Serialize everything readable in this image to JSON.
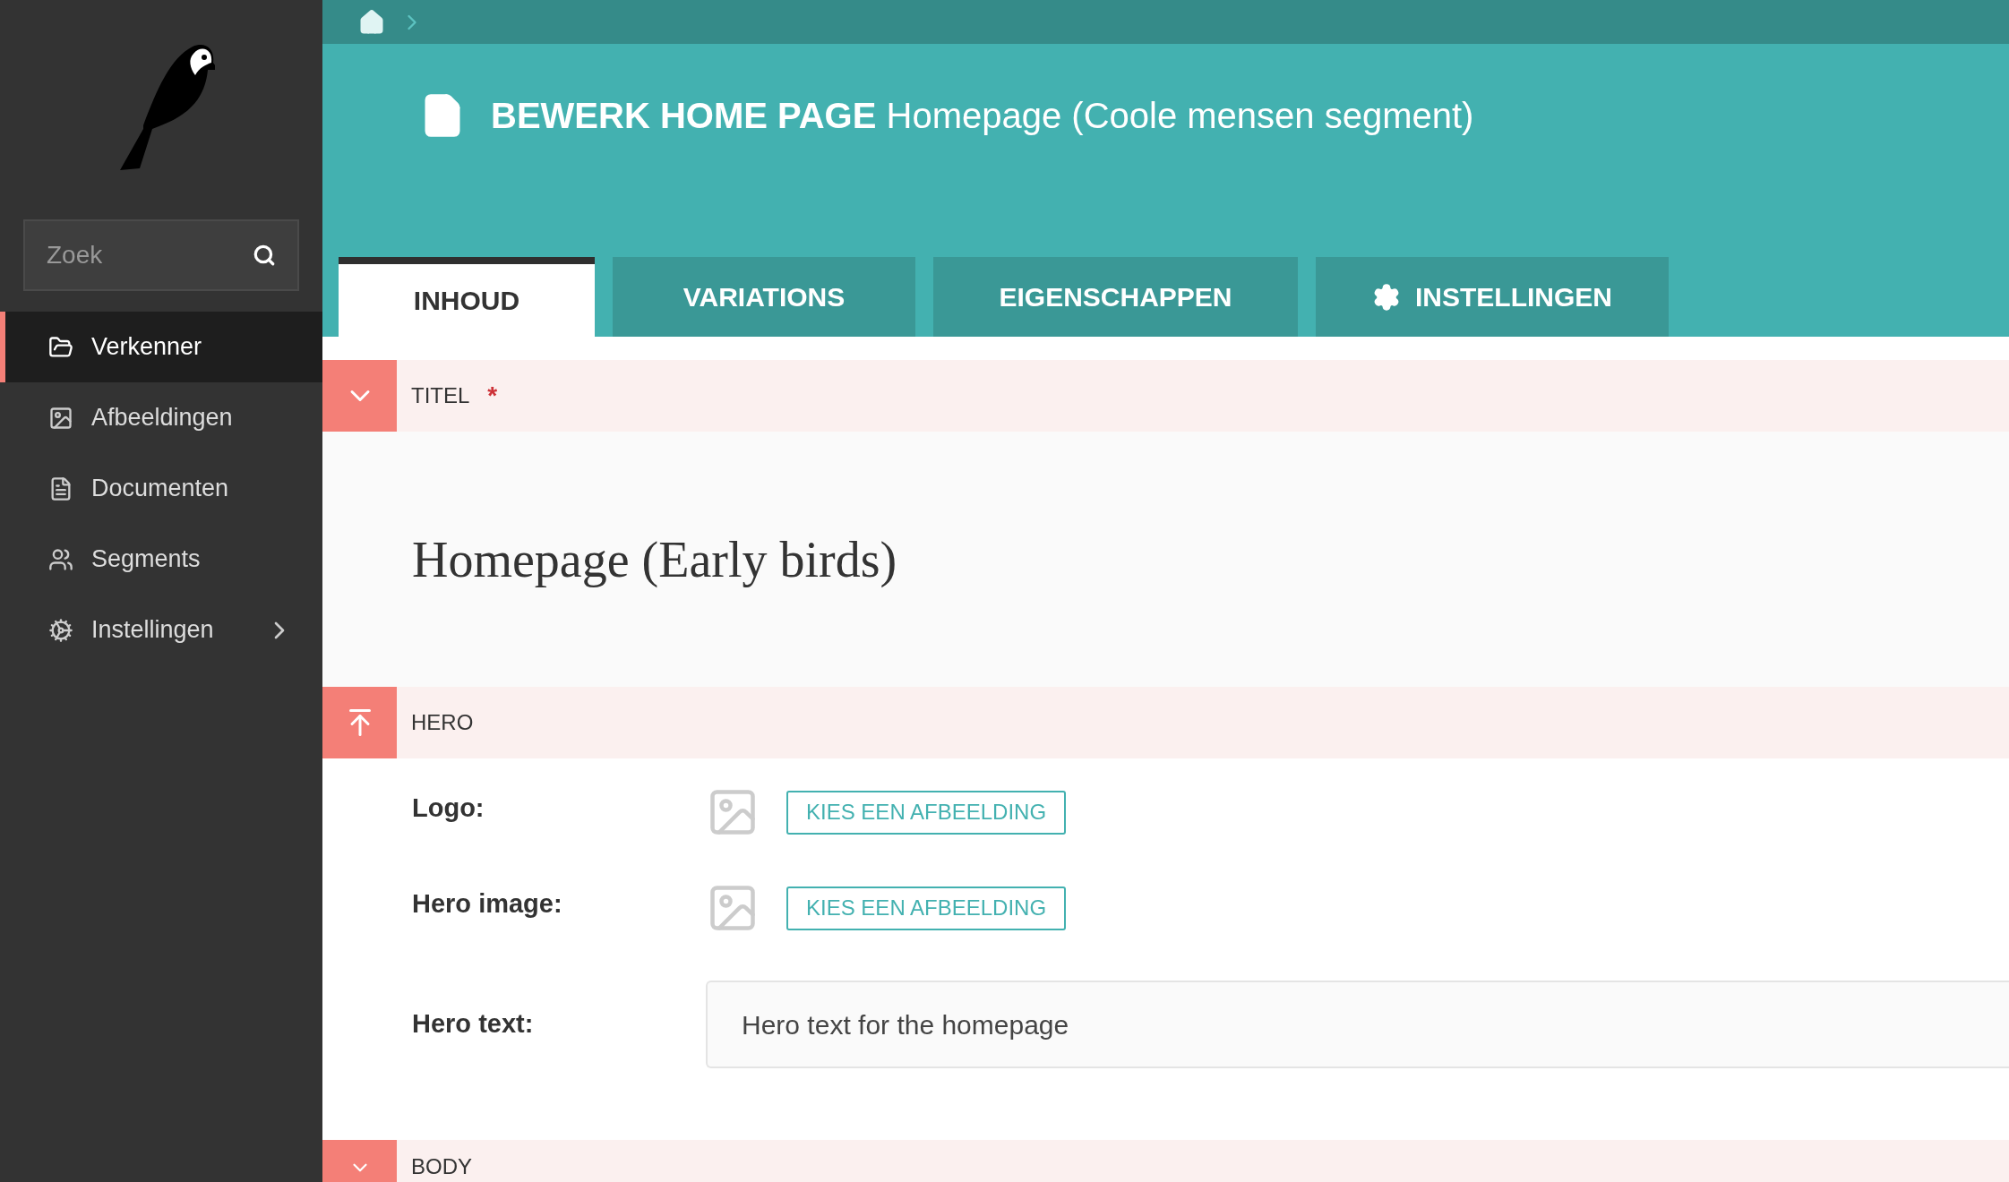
{
  "sidebar": {
    "search": {
      "placeholder": "Zoek"
    },
    "items": [
      {
        "kind": "folder",
        "label": "Verkenner",
        "selected": true,
        "has_submenu": false
      },
      {
        "kind": "image",
        "label": "Afbeeldingen",
        "selected": false,
        "has_submenu": false
      },
      {
        "kind": "document",
        "label": "Documenten",
        "selected": false,
        "has_submenu": false
      },
      {
        "kind": "group",
        "label": "Segments",
        "selected": false,
        "has_submenu": false
      },
      {
        "kind": "gears",
        "label": "Instellingen",
        "selected": false,
        "has_submenu": true
      }
    ]
  },
  "header": {
    "title": "BEWERK HOME PAGE",
    "subtitle": "Homepage (Coole mensen segment)"
  },
  "tabs": [
    {
      "kind": "plain",
      "label": "INHOUD",
      "selected": true
    },
    {
      "kind": "plain",
      "label": "VARIATIONS",
      "selected": false
    },
    {
      "kind": "plain",
      "label": "EIGENSCHAPPEN",
      "selected": false
    },
    {
      "kind": "settings",
      "label": "INSTELLINGEN",
      "selected": false
    }
  ],
  "sections": [
    {
      "kind": "collapse",
      "label": "TITEL",
      "required_mark": "*",
      "title_value": "Homepage (Early birds)"
    },
    {
      "kind": "move-up",
      "label": "HERO",
      "fields": [
        {
          "kind": "image",
          "label": "Logo:",
          "button": "KIES EEN AFBEELDING"
        },
        {
          "kind": "image",
          "label": "Hero image:",
          "button": "KIES EEN AFBEELDING"
        },
        {
          "kind": "text",
          "label": "Hero text:",
          "value": "Hero text for the homepage"
        }
      ]
    },
    {
      "kind": "collapse",
      "label": "BODY"
    }
  ]
}
